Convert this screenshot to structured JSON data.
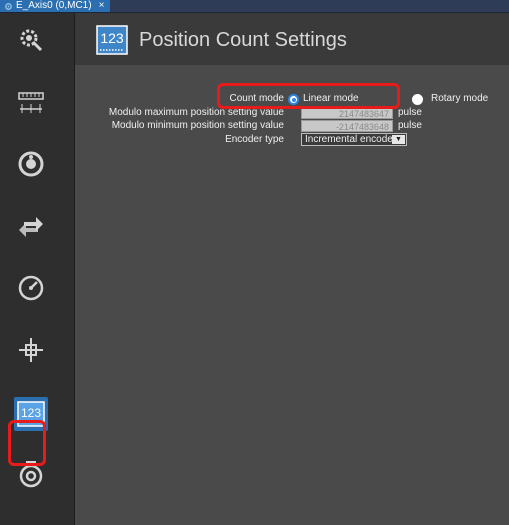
{
  "tab": {
    "label": "E_Axis0 (0,MC1)",
    "close_label": "×"
  },
  "sidebar": {
    "items": [
      {
        "name": "general-settings",
        "icon": "gear-axis-icon"
      },
      {
        "name": "unit-conversion",
        "icon": "ruler-icon"
      },
      {
        "name": "operation-settings",
        "icon": "motor-icon"
      },
      {
        "name": "other-operation",
        "icon": "arrows-icon"
      },
      {
        "name": "limit-settings",
        "icon": "gauge-icon"
      },
      {
        "name": "homing-settings",
        "icon": "crosshair-icon"
      },
      {
        "name": "position-count",
        "icon": "count-123-icon",
        "active": true
      },
      {
        "name": "servo-drive",
        "icon": "timer-icon"
      }
    ]
  },
  "header": {
    "title": "Position Count Settings",
    "icon": "count-123-icon"
  },
  "form": {
    "count_mode": {
      "label": "Count mode",
      "options": [
        {
          "label": "Linear mode",
          "checked": true
        },
        {
          "label": "Rotary mode",
          "checked": false
        }
      ]
    },
    "modulo_max": {
      "label": "Modulo maximum position setting value",
      "value": "2147483647",
      "unit": "pulse"
    },
    "modulo_min": {
      "label": "Modulo minimum position setting value",
      "value": "-2147483648",
      "unit": "pulse"
    },
    "encoder_type": {
      "label": "Encoder type",
      "value": "Incremental encoder",
      "arrow": "▼"
    }
  },
  "colors": {
    "accent": "#2b6fb0",
    "highlight": "#e81b1b",
    "panel": "#4a4a4a",
    "sidebar": "#2e2e2e"
  }
}
